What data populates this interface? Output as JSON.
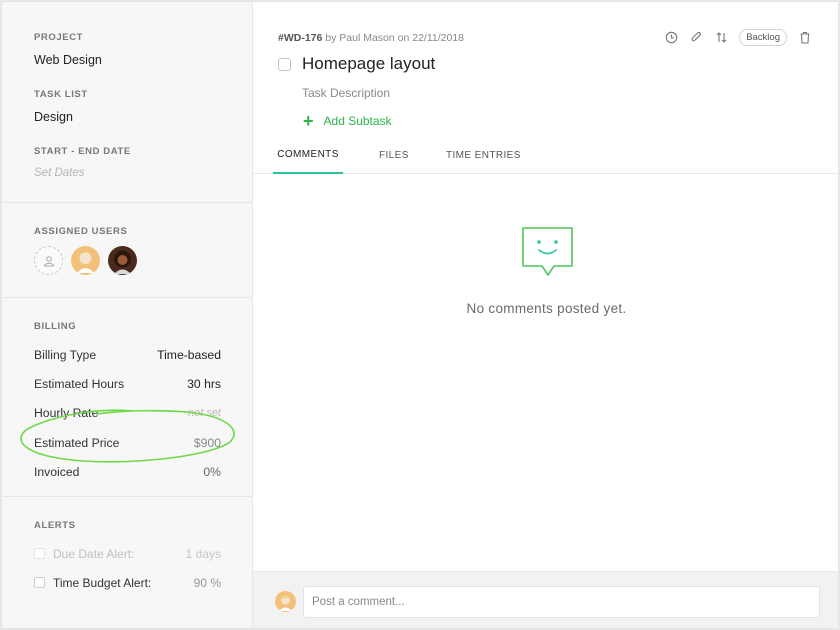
{
  "sidebar": {
    "project_label": "PROJECT",
    "project_value": "Web Design",
    "tasklist_label": "TASK LIST",
    "tasklist_value": "Design",
    "dates_label": "START - END DATE",
    "dates_value": "Set Dates",
    "users_label": "ASSIGNED USERS",
    "billing": {
      "label": "BILLING",
      "rows": [
        {
          "label": "Billing Type",
          "value": "Time-based"
        },
        {
          "label": "Estimated Hours",
          "value": "30 hrs"
        },
        {
          "label": "Hourly Rate",
          "value": "not set"
        },
        {
          "label": "Estimated Price",
          "value": "$900"
        },
        {
          "label": "Invoiced",
          "value": "0%"
        }
      ]
    },
    "alerts": {
      "label": "ALERTS",
      "rows": [
        {
          "label": "Due Date Alert:",
          "value": "1 days"
        },
        {
          "label": "Time Budget Alert:",
          "value": "90 %"
        }
      ]
    }
  },
  "task": {
    "id": "#WD-176",
    "meta_rest": " by Paul Mason on 22/11/2018",
    "status": "Backlog",
    "title": "Homepage layout",
    "description_placeholder": "Task Description",
    "add_subtask": "Add Subtask"
  },
  "tabs": [
    "COMMENTS",
    "FILES",
    "TIME ENTRIES"
  ],
  "empty_state": "No comments posted yet.",
  "comment": {
    "placeholder": "Post a comment..."
  },
  "colors": {
    "accent_green": "#2cb34a",
    "tab_underline": "#2ec4a0",
    "icon_green": "#4cc85a"
  },
  "icons": [
    "clock-icon",
    "paperclip-icon",
    "swap-icon",
    "trash-icon",
    "smile-chat-icon",
    "user-placeholder-icon",
    "plus-icon"
  ]
}
